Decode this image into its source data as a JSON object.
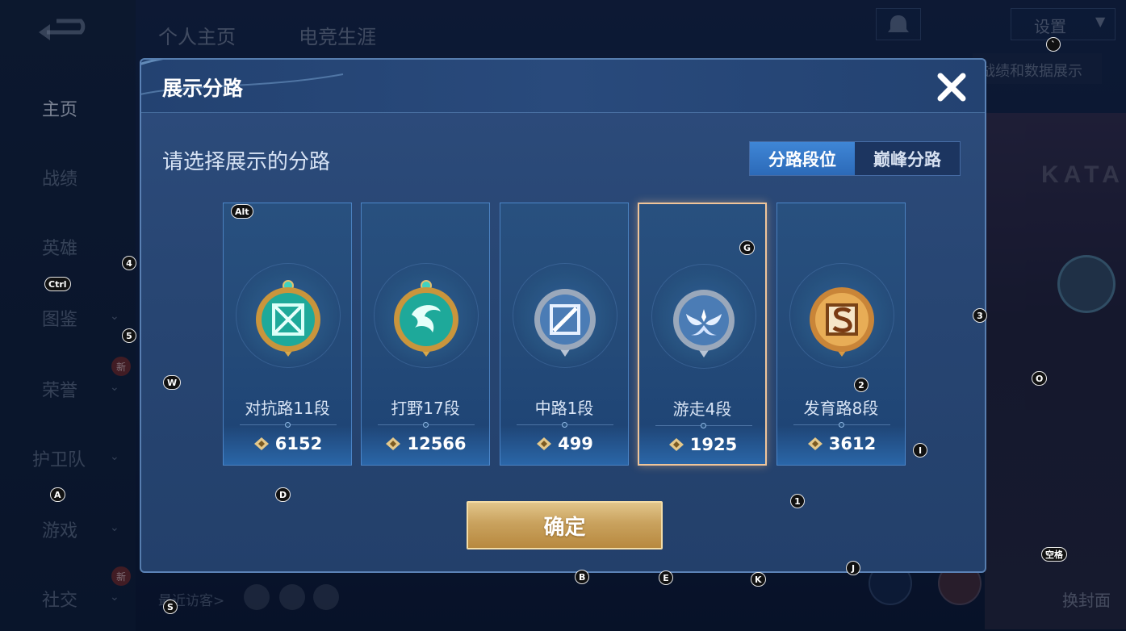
{
  "background": {
    "sidebar_items": [
      {
        "label": "主页",
        "active": true
      },
      {
        "label": "战绩"
      },
      {
        "label": "英雄"
      },
      {
        "label": "图鉴"
      },
      {
        "label": "荣誉"
      },
      {
        "label": "护卫队"
      },
      {
        "label": "游戏"
      },
      {
        "label": "社交"
      }
    ],
    "new_badge": "新",
    "top_tabs": [
      "个人主页",
      "电竞生涯"
    ],
    "settings_label": "设置",
    "data_tab_label": "战绩和数据展示",
    "recent_visitors_label": "最近访客>",
    "cover_label": "换封面",
    "brand_text": "KATA"
  },
  "dialog": {
    "title": "展示分路",
    "subtitle": "请选择展示的分路",
    "tabs": [
      {
        "label": "分路段位",
        "active": true
      },
      {
        "label": "巅峰分路",
        "active": false
      }
    ],
    "cards": [
      {
        "lane": "对抗路11段",
        "score": "6152",
        "emblem": "clash-lane-emblem",
        "emblem_tier": "gold",
        "selected": false
      },
      {
        "lane": "打野17段",
        "score": "12566",
        "emblem": "jungle-emblem",
        "emblem_tier": "gold",
        "selected": false
      },
      {
        "lane": "中路1段",
        "score": "499",
        "emblem": "mid-lane-emblem",
        "emblem_tier": "silver",
        "selected": false
      },
      {
        "lane": "游走4段",
        "score": "1925",
        "emblem": "roam-emblem",
        "emblem_tier": "silver",
        "selected": true
      },
      {
        "lane": "发育路8段",
        "score": "3612",
        "emblem": "farm-lane-emblem",
        "emblem_tier": "bronze",
        "selected": false
      }
    ],
    "confirm_label": "确定",
    "close_icon": "close-icon"
  },
  "colors": {
    "gold": "#e2c58a",
    "selected_border": "#f0c59a",
    "active_tab": "#3f86d6"
  },
  "key_hints": [
    "`",
    "Alt",
    "4",
    "Ctrl",
    "5",
    "W",
    "G",
    "3",
    "2",
    "O",
    "I",
    "A",
    "D",
    "1",
    "B",
    "E",
    "K",
    "J",
    "S",
    "空格"
  ]
}
